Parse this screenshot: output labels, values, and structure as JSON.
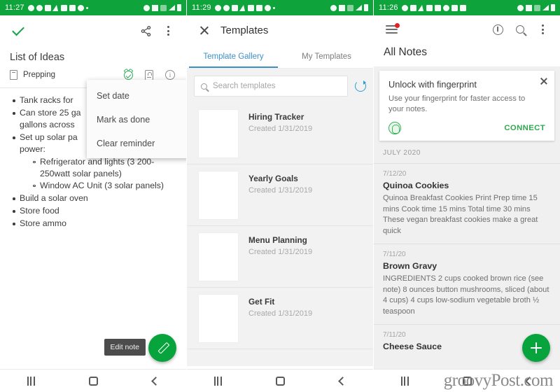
{
  "panels": [
    {
      "statusbar": {
        "time": "11:27"
      },
      "appbar": {
        "back_check": "check-icon",
        "share": "share-icon",
        "overflow": "kebab-icon"
      },
      "note": {
        "title": "List of Ideas",
        "row_label": "Prepping",
        "items": [
          {
            "text": "Tank racks for",
            "level": 1
          },
          {
            "text": "Can store 25 ga",
            "level": 1
          },
          {
            "text": "gallons across",
            "level": 1,
            "cont": true
          },
          {
            "text": "Set up solar pa",
            "level": 1
          },
          {
            "text": "power:",
            "level": 1,
            "cont": true
          },
          {
            "text": "Refrigerator and lights (3 200-",
            "level": 2
          },
          {
            "text": "250watt solar panels)",
            "level": 2,
            "cont": true
          },
          {
            "text": "Window AC Unit (3 solar panels)",
            "level": 2
          },
          {
            "text": "Build a solar oven",
            "level": 1
          },
          {
            "text": "Store food",
            "level": 1
          },
          {
            "text": "Store ammo",
            "level": 1
          }
        ]
      },
      "context_menu": [
        "Set date",
        "Mark as done",
        "Clear reminder"
      ],
      "tooltip": "Edit note",
      "fab": "edit-pencil"
    },
    {
      "statusbar": {
        "time": "11:29"
      },
      "title": "Templates",
      "tabs": [
        {
          "label": "Template Gallery",
          "active": true
        },
        {
          "label": "My Templates",
          "active": false
        }
      ],
      "search": {
        "placeholder": "Search templates",
        "value": ""
      },
      "templates": [
        {
          "name": "Hiring Tracker",
          "date": "Created 1/31/2019"
        },
        {
          "name": "Yearly Goals",
          "date": "Created 1/31/2019"
        },
        {
          "name": "Menu Planning",
          "date": "Created 1/31/2019"
        },
        {
          "name": "Get Fit",
          "date": "Created 1/31/2019"
        }
      ]
    },
    {
      "statusbar": {
        "time": "11:26"
      },
      "heading": "All Notes",
      "fingerprint_card": {
        "title": "Unlock with fingerprint",
        "desc": "Use your fingerprint for faster access to your notes.",
        "action": "CONNECT"
      },
      "month_header": "JULY 2020",
      "notes": [
        {
          "date": "7/12/20",
          "title": "Quinoa Cookies",
          "snippet": "Quinoa Breakfast Cookies   Print Prep time 15 mins Cook time 15 mins Total time 30 mins   These vegan breakfast cookies make a great quick"
        },
        {
          "date": "7/11/20",
          "title": "Brown Gravy",
          "snippet": "INGREDIENTS 2 cups cooked brown rice (see note) 8 ounces button mushrooms, sliced (about 4 cups) 4 cups low-sodium vegetable broth ½ teaspoon"
        },
        {
          "date": "7/11/20",
          "title": "Cheese Sauce",
          "snippet": ""
        }
      ],
      "fab": "add-note"
    }
  ],
  "watermark": "groovyPost.com",
  "colors": {
    "status_green": "#0fa33c",
    "fab_green": "#07a33c",
    "tab_blue": "#3e8fc6",
    "accent_green": "#2fa84f",
    "badge_red": "#e02222"
  }
}
